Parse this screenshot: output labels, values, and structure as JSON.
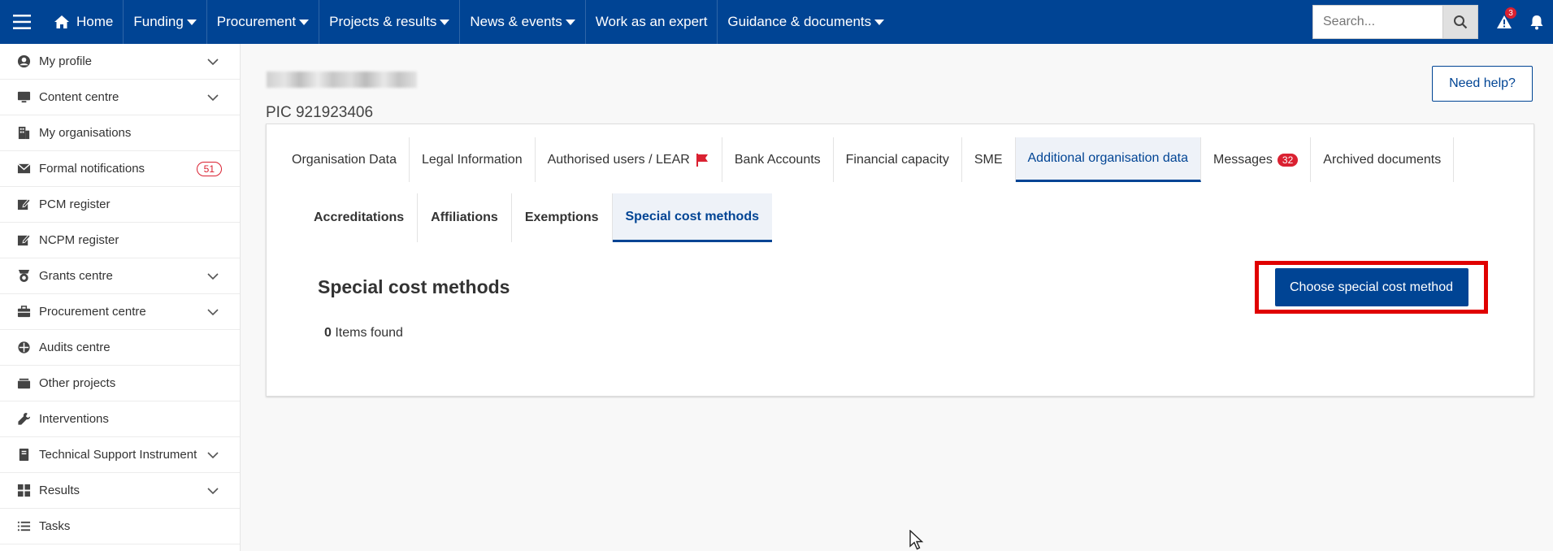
{
  "topnav": {
    "home": "Home",
    "items": [
      {
        "label": "Funding",
        "has_caret": true
      },
      {
        "label": "Procurement",
        "has_caret": true
      },
      {
        "label": "Projects & results",
        "has_caret": true
      },
      {
        "label": "News & events",
        "has_caret": true
      },
      {
        "label": "Work as an expert",
        "has_caret": false
      },
      {
        "label": "Guidance & documents",
        "has_caret": true
      }
    ],
    "search_placeholder": "Search...",
    "alert_count": "3"
  },
  "sidebar": {
    "items": [
      {
        "label": "My profile",
        "icon": "user-circle-icon",
        "expandable": true
      },
      {
        "label": "Content centre",
        "icon": "monitor-icon",
        "expandable": true
      },
      {
        "label": "My organisations",
        "icon": "building-icon",
        "expandable": false
      },
      {
        "label": "Formal notifications",
        "icon": "envelope-icon",
        "expandable": false,
        "badge": "51"
      },
      {
        "label": "PCM register",
        "icon": "edit-icon",
        "expandable": false
      },
      {
        "label": "NCPM register",
        "icon": "edit-icon",
        "expandable": false
      },
      {
        "label": "Grants centre",
        "icon": "award-icon",
        "expandable": true
      },
      {
        "label": "Procurement centre",
        "icon": "briefcase-icon",
        "expandable": true
      },
      {
        "label": "Audits centre",
        "icon": "crosshair-icon",
        "expandable": false
      },
      {
        "label": "Other projects",
        "icon": "folder-icon",
        "expandable": false
      },
      {
        "label": "Interventions",
        "icon": "wrench-icon",
        "expandable": false
      },
      {
        "label": "Technical Support Instrument",
        "icon": "book-icon",
        "expandable": true
      },
      {
        "label": "Results",
        "icon": "grid-icon",
        "expandable": true
      },
      {
        "label": "Tasks",
        "icon": "list-icon",
        "expandable": false
      }
    ]
  },
  "header": {
    "pic": "PIC 921923406",
    "help_label": "Need help?"
  },
  "tabs": [
    {
      "label": "Organisation Data",
      "active": false
    },
    {
      "label": "Legal Information",
      "active": false
    },
    {
      "label": "Authorised users / LEAR",
      "active": false,
      "flag": true
    },
    {
      "label": "Bank Accounts",
      "active": false
    },
    {
      "label": "Financial capacity",
      "active": false
    },
    {
      "label": "SME",
      "active": false
    },
    {
      "label": "Additional organisation data",
      "active": true
    },
    {
      "label": "Messages",
      "active": false,
      "badge": "32"
    },
    {
      "label": "Archived documents",
      "active": false
    }
  ],
  "subtabs": [
    {
      "label": "Accreditations",
      "active": false
    },
    {
      "label": "Affiliations",
      "active": false
    },
    {
      "label": "Exemptions",
      "active": false
    },
    {
      "label": "Special cost methods",
      "active": true
    }
  ],
  "content": {
    "title": "Special cost methods",
    "items_count": "0",
    "items_suffix": " Items found",
    "cta_label": "Choose special cost method"
  },
  "colors": {
    "primary": "#004494",
    "badge_red": "#da2131",
    "highlight_red": "#e00000"
  }
}
